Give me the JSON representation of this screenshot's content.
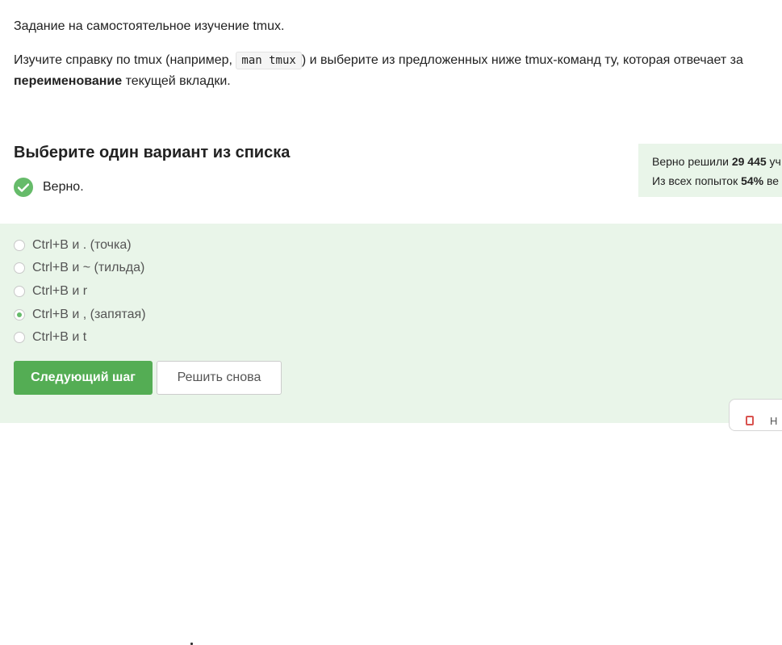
{
  "task": {
    "intro": "Задание на самостоятельное изучение tmux.",
    "text_before_code": "Изучите справку по tmux (например, ",
    "code": "man tmux",
    "text_after_code": ") и выберите из предложенных ниже tmux-команд ту, которая отвечает за",
    "bold_word": "переименование",
    "text_end": " текущей вкладки."
  },
  "quiz": {
    "title": "Выберите один вариант из списка",
    "status_text": "Верно.",
    "options": [
      {
        "label": "Ctrl+B и . (точка)",
        "selected": false
      },
      {
        "label": "Ctrl+B и ~ (тильда)",
        "selected": false
      },
      {
        "label": "Ctrl+B и r",
        "selected": false
      },
      {
        "label": "Ctrl+B и , (запятая)",
        "selected": true
      },
      {
        "label": "Ctrl+B и t",
        "selected": false
      }
    ],
    "next_button": "Следующий шаг",
    "retry_button": "Решить снова"
  },
  "stats": {
    "solved_prefix": "Верно решили ",
    "solved_count": "29 445",
    "solved_suffix": " уч",
    "attempts_prefix": "Из всех попыток ",
    "attempts_percent": "54%",
    "attempts_suffix": " ве"
  },
  "widget": {
    "label": "Н"
  },
  "colors": {
    "accent_green": "#54ad54",
    "check_green": "#66bb6a",
    "answer_bg": "#e9f5e9"
  }
}
